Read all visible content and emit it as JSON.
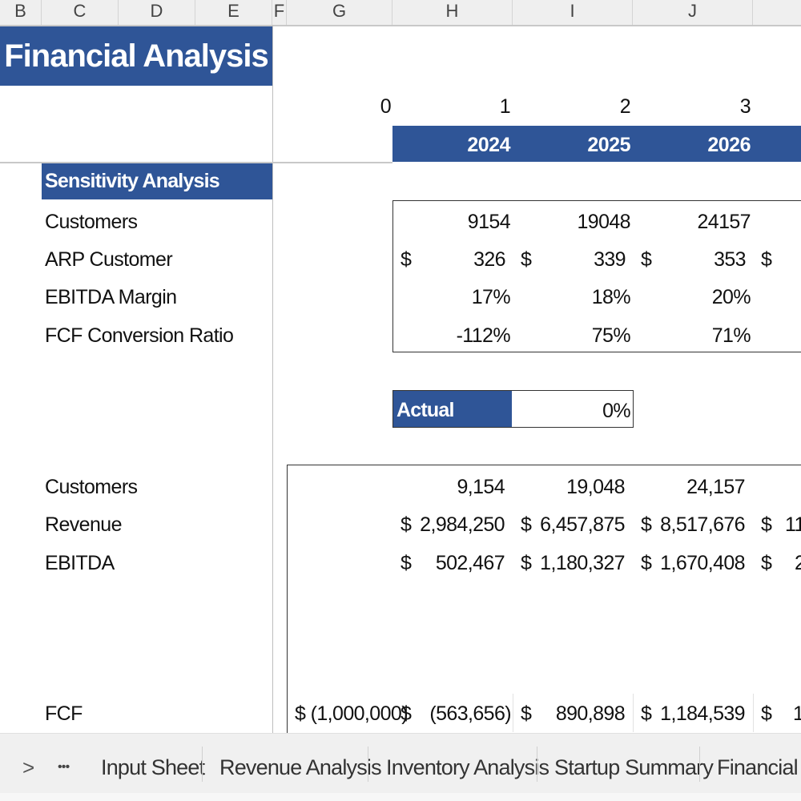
{
  "columns": [
    "B",
    "C",
    "D",
    "E",
    "F",
    "G",
    "H",
    "I",
    "J",
    ""
  ],
  "title": "Financial Analysis",
  "period_index": [
    "0",
    "1",
    "2",
    "3"
  ],
  "years": [
    "2024",
    "2025",
    "2026"
  ],
  "sensitivity": {
    "header": "Sensitivity Analysis",
    "rows": [
      {
        "label": "Customers",
        "currency": false,
        "values": [
          "9154",
          "19048",
          "24157"
        ]
      },
      {
        "label": "ARP Customer",
        "currency": true,
        "values": [
          "326",
          "339",
          "353"
        ]
      },
      {
        "label": "EBITDA Margin",
        "currency": false,
        "values": [
          "17%",
          "18%",
          "20%"
        ]
      },
      {
        "label": "FCF Conversion Ratio",
        "currency": false,
        "values": [
          "-112%",
          "75%",
          "71%"
        ]
      }
    ]
  },
  "actual": {
    "label": "Actual",
    "value": "0%"
  },
  "summary": {
    "rows": [
      {
        "label": "Customers",
        "currency": false,
        "values": [
          "9,154",
          "19,048",
          "24,157"
        ],
        "partial": ""
      },
      {
        "label": "Revenue",
        "currency": true,
        "values": [
          "2,984,250",
          "6,457,875",
          "8,517,676"
        ],
        "partial": "11"
      },
      {
        "label": "EBITDA",
        "currency": true,
        "values": [
          "502,467",
          "1,180,327",
          "1,670,408"
        ],
        "partial": "2"
      }
    ],
    "fcf": {
      "label": "FCF",
      "initial": "$ (1,000,000)",
      "values": [
        "(563,656)",
        "890,898",
        "1,184,539"
      ],
      "partial": "1"
    }
  },
  "currency_symbol": "$",
  "sheet_tabs": {
    "nav_next": ">",
    "more": "•••",
    "tabs": [
      "Input Sheet",
      "Revenue Analysis",
      "Inventory Analysis",
      "Startup Summary",
      "Financial St"
    ]
  },
  "colors": {
    "accent": "#2f5597"
  }
}
